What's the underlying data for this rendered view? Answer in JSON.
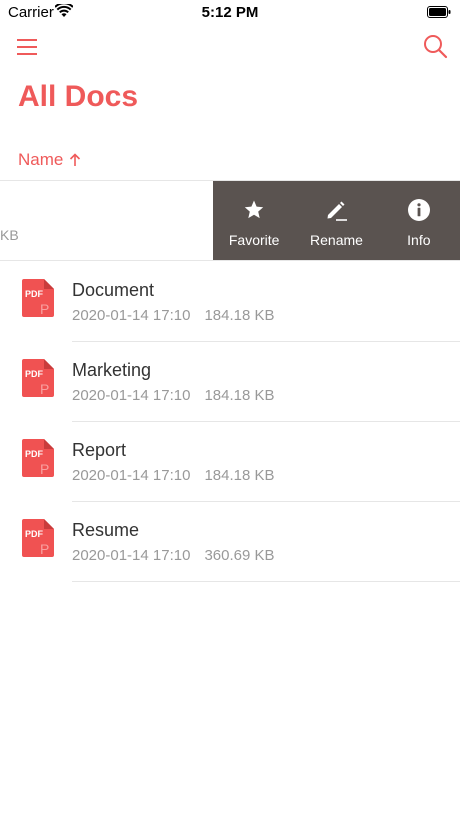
{
  "status_bar": {
    "carrier": "Carrier",
    "time": "5:12 PM"
  },
  "header": {
    "title": "All Docs",
    "menu_icon": "hamburger-icon",
    "search_icon": "search-icon"
  },
  "sort": {
    "label": "Name",
    "direction": "ascending"
  },
  "swiped_row": {
    "size_fragment": "KB",
    "actions": [
      {
        "label": "Favorite",
        "icon": "star-icon"
      },
      {
        "label": "Rename",
        "icon": "pencil-icon"
      },
      {
        "label": "Info",
        "icon": "info-icon"
      }
    ]
  },
  "documents": [
    {
      "name": "Document",
      "date": "2020-01-14 17:10",
      "size": "184.18 KB",
      "type": "PDF"
    },
    {
      "name": "Marketing",
      "date": "2020-01-14 17:10",
      "size": "184.18 KB",
      "type": "PDF"
    },
    {
      "name": "Report",
      "date": "2020-01-14 17:10",
      "size": "184.18 KB",
      "type": "PDF"
    },
    {
      "name": "Resume",
      "date": "2020-01-14 17:10",
      "size": "360.69 KB",
      "type": "PDF"
    }
  ],
  "colors": {
    "accent": "#ef5a5a",
    "action_bg": "#5a5350",
    "pdf_red": "#f05252"
  }
}
